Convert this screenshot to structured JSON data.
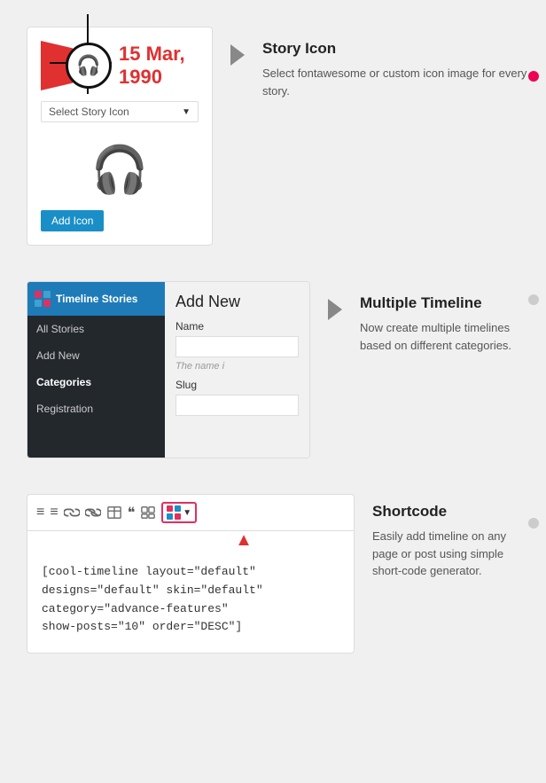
{
  "sections": {
    "storyIcon": {
      "date": "15 Mar, 1990",
      "selectLabel": "Select Story Icon",
      "addIconBtn": "Add Icon",
      "title": "Story Icon",
      "description": "Select fontawesome or custom icon image for every story."
    },
    "multipleTimeline": {
      "pluginName": "Timeline Stories",
      "menuItems": [
        "All Stories",
        "Add New",
        "Categories",
        "Registration"
      ],
      "activeMenu": "Categories",
      "contentTitle": "Add New",
      "nameLabel": "Name",
      "namePlaceholder": "",
      "nameHint": "The name i",
      "slugLabel": "Slug",
      "title": "Multiple Timeline",
      "description": "Now create multiple timelines based on different categories."
    },
    "shortcode": {
      "shortcodeText": "[cool-timeline layout=\"default\"\ndesigns=\"default\" skin=\"default\"\ncategory=\"advance-features\"\nshow-posts=\"10\" order=\"DESC\"]",
      "title": "Shortcode",
      "description": "Easily add timeline on any page or post using simple short-code generator."
    }
  },
  "toolbar": {
    "icons": [
      "≡",
      "≡",
      "🔗",
      "✕",
      "▦",
      "❝",
      "▦"
    ]
  }
}
